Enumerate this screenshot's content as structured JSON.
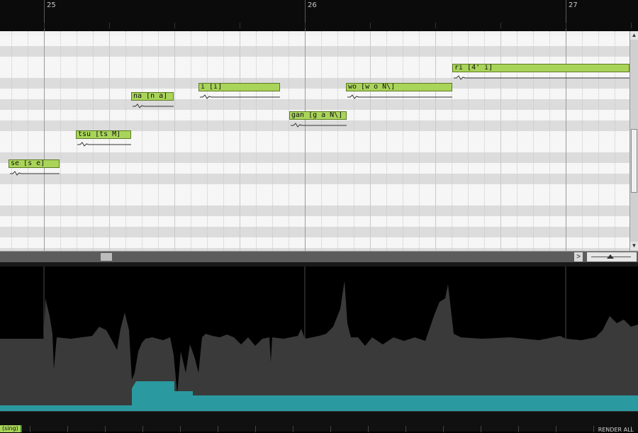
{
  "ruler": {
    "bars": [
      {
        "label": "25"
      },
      {
        "label": "26"
      },
      {
        "label": "27"
      }
    ]
  },
  "notes": [
    {
      "lyric": "se [s e]"
    },
    {
      "lyric": "tsu [ts M]"
    },
    {
      "lyric": "na [n a]"
    },
    {
      "lyric": "i [i]"
    },
    {
      "lyric": "gan [g a N\\]"
    },
    {
      "lyric": "wo [w o N\\]"
    },
    {
      "lyric": "ri [4' i]"
    }
  ],
  "scrollbar": {
    "right_arrow": ">"
  },
  "track": {
    "tab_label": "(sing)"
  },
  "toolbar": {
    "render_label": "RENDER ALL"
  },
  "colors": {
    "note_fill": "#a9d45a",
    "note_border": "#5d7a22",
    "waveform": "#3a3a3a",
    "param_curve": "#2a9aa0"
  }
}
